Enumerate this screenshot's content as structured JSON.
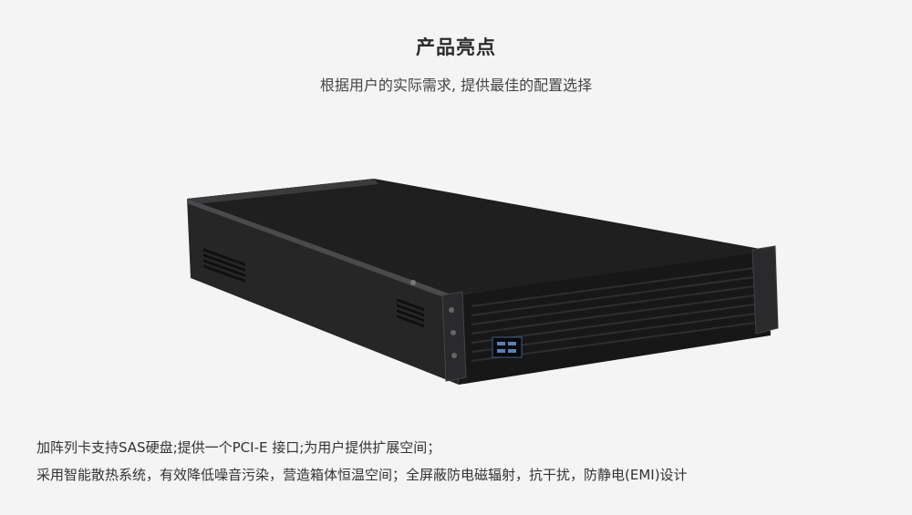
{
  "header": {
    "title": "产品亮点",
    "subtitle": "根据用户的实际需求, 提供最佳的配置选择"
  },
  "product_image": {
    "icon": "server-chassis-image"
  },
  "features": [
    "加阵列卡支持SAS硬盘;提供一个PCI-E 接口;为用户提供扩展空间；",
    "采用智能散热系统，有效降低噪音污染，营造箱体恒温空间；全屏蔽防电磁辐射，抗干扰，防静电(EMI)设计"
  ]
}
